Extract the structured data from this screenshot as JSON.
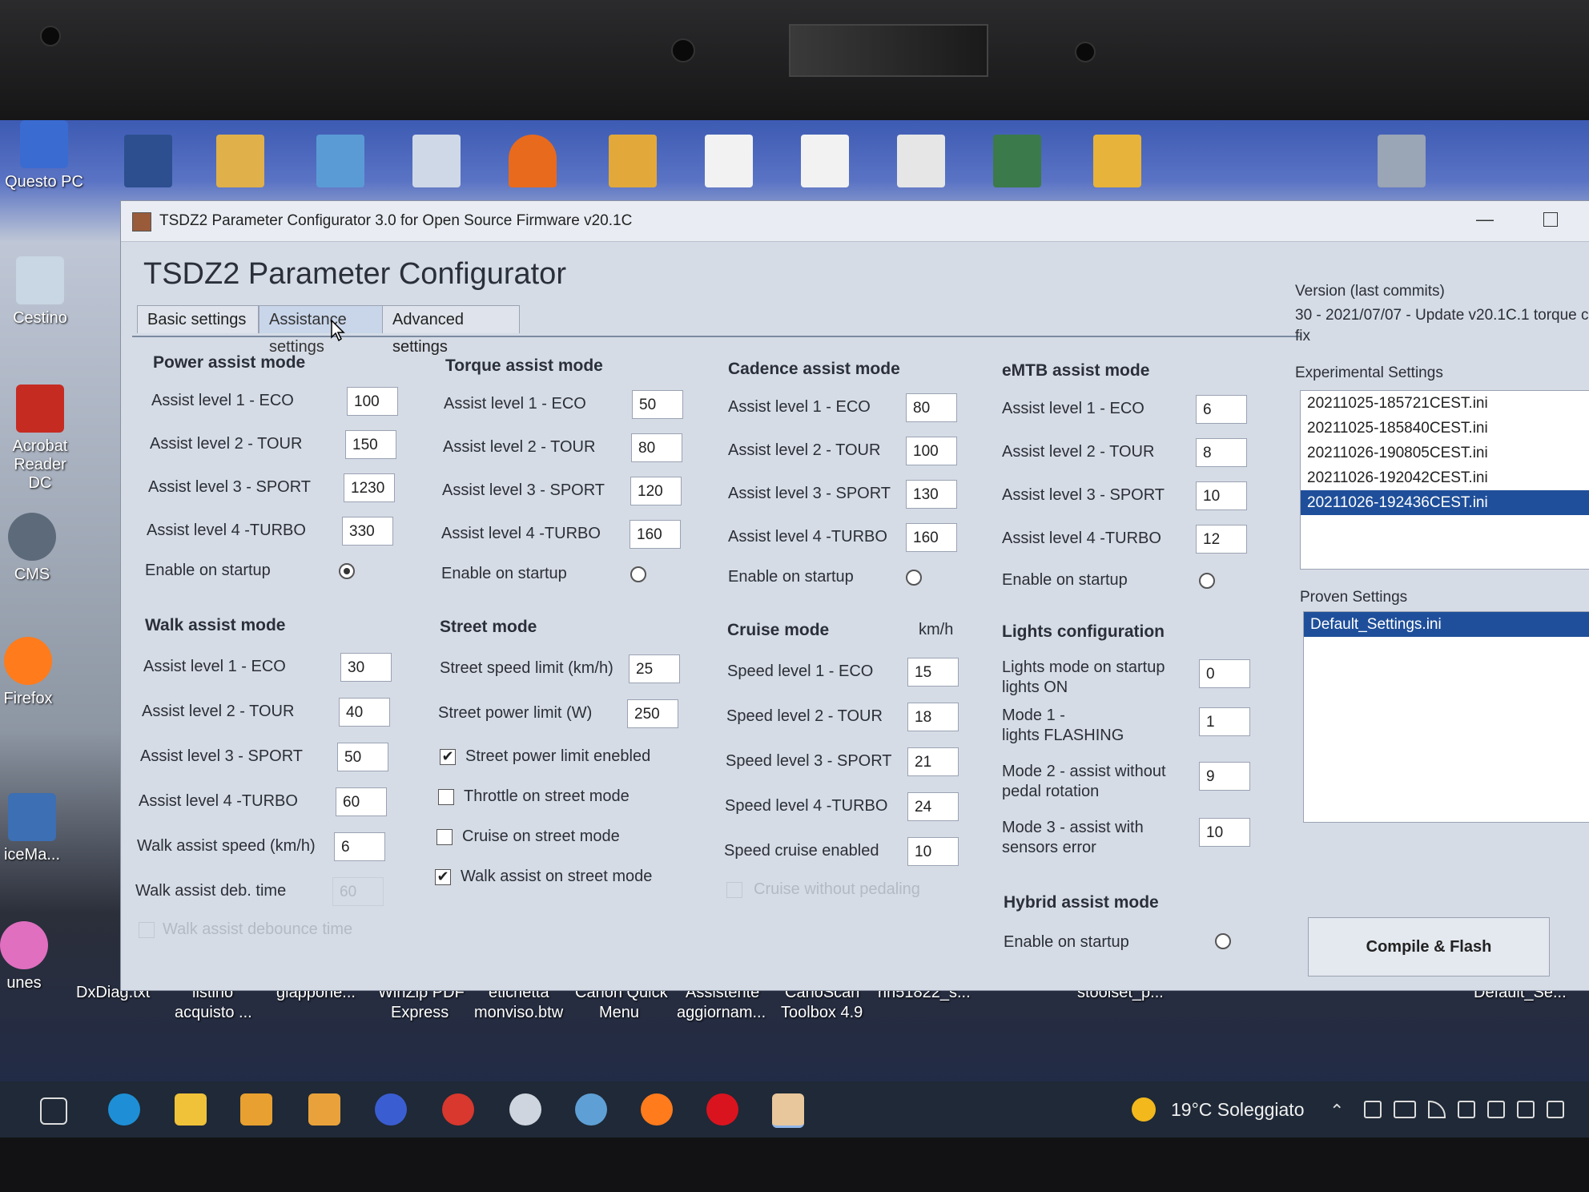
{
  "window": {
    "title": "TSDZ2 Parameter Configurator 3.0 for Open Source Firmware v20.1C",
    "heading": "TSDZ2 Parameter Configurator"
  },
  "tabs": [
    "Basic settings",
    "Assistance settings",
    "Advanced settings"
  ],
  "power": {
    "title": "Power assist mode",
    "rows": [
      {
        "label": "Assist level 1 - ECO",
        "value": "100"
      },
      {
        "label": "Assist level 2 - TOUR",
        "value": "150"
      },
      {
        "label": "Assist level 3 - SPORT",
        "value": "1230"
      },
      {
        "label": "Assist level 4 -TURBO",
        "value": "330"
      }
    ],
    "enable_label": "Enable on startup",
    "enabled": true
  },
  "torque": {
    "title": "Torque assist mode",
    "rows": [
      {
        "label": "Assist level 1 - ECO",
        "value": "50"
      },
      {
        "label": "Assist level 2 - TOUR",
        "value": "80"
      },
      {
        "label": "Assist level 3 - SPORT",
        "value": "120"
      },
      {
        "label": "Assist level 4 -TURBO",
        "value": "160"
      }
    ],
    "enable_label": "Enable on startup",
    "enabled": false
  },
  "cadence": {
    "title": "Cadence assist mode",
    "rows": [
      {
        "label": "Assist level 1 - ECO",
        "value": "80"
      },
      {
        "label": "Assist level 2 - TOUR",
        "value": "100"
      },
      {
        "label": "Assist level 3 - SPORT",
        "value": "130"
      },
      {
        "label": "Assist level 4 -TURBO",
        "value": "160"
      }
    ],
    "enable_label": "Enable on startup",
    "enabled": false
  },
  "emtb": {
    "title": "eMTB assist mode",
    "rows": [
      {
        "label": "Assist level 1 - ECO",
        "value": "6"
      },
      {
        "label": "Assist level 2 - TOUR",
        "value": "8"
      },
      {
        "label": "Assist level 3 - SPORT",
        "value": "10"
      },
      {
        "label": "Assist level 4 -TURBO",
        "value": "12"
      }
    ],
    "enable_label": "Enable on startup",
    "enabled": false
  },
  "walk": {
    "title": "Walk assist mode",
    "rows": [
      {
        "label": "Assist level 1 - ECO",
        "value": "30"
      },
      {
        "label": "Assist level 2 - TOUR",
        "value": "40"
      },
      {
        "label": "Assist level 3 - SPORT",
        "value": "50"
      },
      {
        "label": "Assist level 4 -TURBO",
        "value": "60"
      }
    ],
    "speed_label": "Walk assist speed (km/h)",
    "speed_value": "6",
    "deb_label": "Walk assist deb. time",
    "deb_value": "60",
    "debounce_label": "Walk assist debounce time"
  },
  "street": {
    "title": "Street mode",
    "speed_label": "Street speed limit (km/h)",
    "speed_value": "25",
    "power_label": "Street power limit (W)",
    "power_value": "250",
    "checks": [
      {
        "label": "Street power limit enebled",
        "checked": true
      },
      {
        "label": "Throttle on street mode",
        "checked": false
      },
      {
        "label": "Cruise on street mode",
        "checked": false
      },
      {
        "label": "Walk assist on street mode",
        "checked": true
      }
    ]
  },
  "cruise": {
    "title": "Cruise mode",
    "unit": "km/h",
    "rows": [
      {
        "label": "Speed level 1 - ECO",
        "value": "15"
      },
      {
        "label": "Speed level 2 - TOUR",
        "value": "18"
      },
      {
        "label": "Speed level 3 - SPORT",
        "value": "21"
      },
      {
        "label": "Speed level 4 -TURBO",
        "value": "24"
      },
      {
        "label": "Speed cruise enabled",
        "value": "10"
      }
    ],
    "without_pedaling_label": "Cruise without pedaling"
  },
  "lights": {
    "title": "Lights configuration",
    "rows": [
      {
        "l1": "Lights mode on startup",
        "l2": "lights ON",
        "value": "0"
      },
      {
        "l1": "Mode 1 -",
        "l2": "lights FLASHING",
        "value": "1"
      },
      {
        "l1": "Mode 2 - assist without",
        "l2": "pedal rotation",
        "value": "9"
      },
      {
        "l1": "Mode 3 - assist with",
        "l2": "sensors error",
        "value": "10"
      }
    ]
  },
  "hybrid": {
    "title": "Hybrid assist mode",
    "enable_label": "Enable on startup",
    "enabled": false
  },
  "sidebar": {
    "version_label": "Version (last commits)",
    "version_text_1": "30 - 2021/07/07 - Update v20.1C.1 torque c",
    "version_text_2": "fix",
    "experimental_label": "Experimental Settings",
    "experimental": [
      "20211025-185721CEST.ini",
      "20211025-185840CEST.ini",
      "20211026-190805CEST.ini",
      "20211026-192042CEST.ini",
      "20211026-192436CEST.ini"
    ],
    "proven_label": "Proven Settings",
    "proven": [
      "Default_Settings.ini"
    ],
    "compile_label": "Compile & Flash"
  },
  "desktop": {
    "left_icons": [
      "Questo PC",
      "Cestino",
      "Acrobat",
      "Reader DC",
      "CMS",
      "Firefox",
      "iceMa...",
      "unes"
    ],
    "bottom_labels": [
      "DxDiag.txt",
      "listino",
      "acquisto ...",
      "giappone...",
      "WinZip PDF",
      "Express",
      "etichetta",
      "monviso.btw",
      "Canon Quick",
      "Menu",
      "Assistente",
      "aggiornam...",
      "CanoScan",
      "Toolbox 4.9",
      "rin51822_s...",
      "stoolset_p...",
      "Default_Se..."
    ]
  },
  "taskbar": {
    "weather": "19°C  Soleggiato"
  },
  "colors": {
    "selection": "#1f4f9a",
    "window_bg": "#d6dce6",
    "taskbar": "#1f2937"
  }
}
